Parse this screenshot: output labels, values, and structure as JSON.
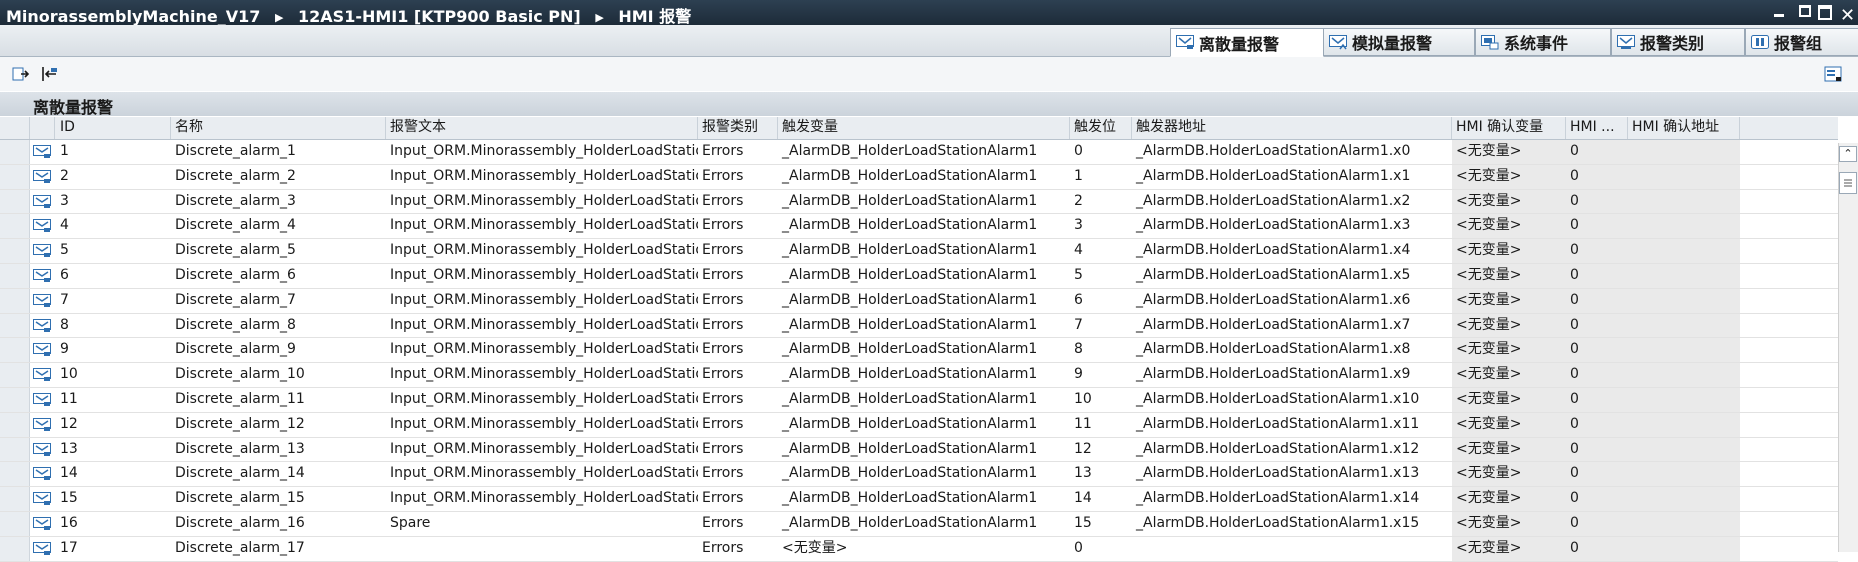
{
  "titlebar": {
    "crumbs": [
      "MinorassemblyMachine_V17",
      "12AS1-HMI1 [KTP900 Basic PN]",
      "HMI 报警"
    ],
    "separator": "▶"
  },
  "tabs": [
    {
      "label": "离散量报警",
      "active": true
    },
    {
      "label": "模拟量报警",
      "active": false
    },
    {
      "label": "系统事件",
      "active": false
    },
    {
      "label": "报警类别",
      "active": false
    },
    {
      "label": "报警组",
      "active": false
    }
  ],
  "section_title": "离散量报警",
  "columns": {
    "id": "ID",
    "name": "名称",
    "text": "报警文本",
    "class": "报警类别",
    "trigger": "触发变量",
    "bit": "触发位",
    "address": "触发器地址",
    "ack": "HMI 确认变量",
    "hmi": "HMI ...",
    "ack_address": "HMI 确认地址"
  },
  "rows": [
    {
      "id": "1",
      "name": "Discrete_alarm_1",
      "text": "Input_ORM.Minorassembly_HolderLoadStatio",
      "cls": "Errors",
      "trig": "_AlarmDB_HolderLoadStationAlarm1",
      "bit": "0",
      "addr": "_AlarmDB.HolderLoadStationAlarm1.x0",
      "ack": "<无变量>",
      "hmi": "0"
    },
    {
      "id": "2",
      "name": "Discrete_alarm_2",
      "text": "Input_ORM.Minorassembly_HolderLoadStatio",
      "cls": "Errors",
      "trig": "_AlarmDB_HolderLoadStationAlarm1",
      "bit": "1",
      "addr": "_AlarmDB.HolderLoadStationAlarm1.x1",
      "ack": "<无变量>",
      "hmi": "0"
    },
    {
      "id": "3",
      "name": "Discrete_alarm_3",
      "text": "Input_ORM.Minorassembly_HolderLoadStatio",
      "cls": "Errors",
      "trig": "_AlarmDB_HolderLoadStationAlarm1",
      "bit": "2",
      "addr": "_AlarmDB.HolderLoadStationAlarm1.x2",
      "ack": "<无变量>",
      "hmi": "0"
    },
    {
      "id": "4",
      "name": "Discrete_alarm_4",
      "text": "Input_ORM.Minorassembly_HolderLoadStatio",
      "cls": "Errors",
      "trig": "_AlarmDB_HolderLoadStationAlarm1",
      "bit": "3",
      "addr": "_AlarmDB.HolderLoadStationAlarm1.x3",
      "ack": "<无变量>",
      "hmi": "0"
    },
    {
      "id": "5",
      "name": "Discrete_alarm_5",
      "text": "Input_ORM.Minorassembly_HolderLoadStatio",
      "cls": "Errors",
      "trig": "_AlarmDB_HolderLoadStationAlarm1",
      "bit": "4",
      "addr": "_AlarmDB.HolderLoadStationAlarm1.x4",
      "ack": "<无变量>",
      "hmi": "0"
    },
    {
      "id": "6",
      "name": "Discrete_alarm_6",
      "text": "Input_ORM.Minorassembly_HolderLoadStatio",
      "cls": "Errors",
      "trig": "_AlarmDB_HolderLoadStationAlarm1",
      "bit": "5",
      "addr": "_AlarmDB.HolderLoadStationAlarm1.x5",
      "ack": "<无变量>",
      "hmi": "0"
    },
    {
      "id": "7",
      "name": "Discrete_alarm_7",
      "text": "Input_ORM.Minorassembly_HolderLoadStatio",
      "cls": "Errors",
      "trig": "_AlarmDB_HolderLoadStationAlarm1",
      "bit": "6",
      "addr": "_AlarmDB.HolderLoadStationAlarm1.x6",
      "ack": "<无变量>",
      "hmi": "0"
    },
    {
      "id": "8",
      "name": "Discrete_alarm_8",
      "text": "Input_ORM.Minorassembly_HolderLoadStatio",
      "cls": "Errors",
      "trig": "_AlarmDB_HolderLoadStationAlarm1",
      "bit": "7",
      "addr": "_AlarmDB.HolderLoadStationAlarm1.x7",
      "ack": "<无变量>",
      "hmi": "0"
    },
    {
      "id": "9",
      "name": "Discrete_alarm_9",
      "text": "Input_ORM.Minorassembly_HolderLoadStatio",
      "cls": "Errors",
      "trig": "_AlarmDB_HolderLoadStationAlarm1",
      "bit": "8",
      "addr": "_AlarmDB.HolderLoadStationAlarm1.x8",
      "ack": "<无变量>",
      "hmi": "0"
    },
    {
      "id": "10",
      "name": "Discrete_alarm_10",
      "text": "Input_ORM.Minorassembly_HolderLoadStatio",
      "cls": "Errors",
      "trig": "_AlarmDB_HolderLoadStationAlarm1",
      "bit": "9",
      "addr": "_AlarmDB.HolderLoadStationAlarm1.x9",
      "ack": "<无变量>",
      "hmi": "0"
    },
    {
      "id": "11",
      "name": "Discrete_alarm_11",
      "text": "Input_ORM.Minorassembly_HolderLoadStatio",
      "cls": "Errors",
      "trig": "_AlarmDB_HolderLoadStationAlarm1",
      "bit": "10",
      "addr": "_AlarmDB.HolderLoadStationAlarm1.x10",
      "ack": "<无变量>",
      "hmi": "0"
    },
    {
      "id": "12",
      "name": "Discrete_alarm_12",
      "text": "Input_ORM.Minorassembly_HolderLoadStatio",
      "cls": "Errors",
      "trig": "_AlarmDB_HolderLoadStationAlarm1",
      "bit": "11",
      "addr": "_AlarmDB.HolderLoadStationAlarm1.x11",
      "ack": "<无变量>",
      "hmi": "0"
    },
    {
      "id": "13",
      "name": "Discrete_alarm_13",
      "text": "Input_ORM.Minorassembly_HolderLoadStatio",
      "cls": "Errors",
      "trig": "_AlarmDB_HolderLoadStationAlarm1",
      "bit": "12",
      "addr": "_AlarmDB.HolderLoadStationAlarm1.x12",
      "ack": "<无变量>",
      "hmi": "0"
    },
    {
      "id": "14",
      "name": "Discrete_alarm_14",
      "text": "Input_ORM.Minorassembly_HolderLoadStatio",
      "cls": "Errors",
      "trig": "_AlarmDB_HolderLoadStationAlarm1",
      "bit": "13",
      "addr": "_AlarmDB.HolderLoadStationAlarm1.x13",
      "ack": "<无变量>",
      "hmi": "0"
    },
    {
      "id": "15",
      "name": "Discrete_alarm_15",
      "text": "Input_ORM.Minorassembly_HolderLoadStatio",
      "cls": "Errors",
      "trig": "_AlarmDB_HolderLoadStationAlarm1",
      "bit": "14",
      "addr": "_AlarmDB.HolderLoadStationAlarm1.x14",
      "ack": "<无变量>",
      "hmi": "0"
    },
    {
      "id": "16",
      "name": "Discrete_alarm_16",
      "text": "Spare",
      "cls": "Errors",
      "trig": "_AlarmDB_HolderLoadStationAlarm1",
      "bit": "15",
      "addr": "_AlarmDB.HolderLoadStationAlarm1.x15",
      "ack": "<无变量>",
      "hmi": "0"
    },
    {
      "id": "17",
      "name": "Discrete_alarm_17",
      "text": "",
      "cls": "Errors",
      "trig": "<无变量>",
      "bit": "0",
      "addr": "",
      "ack": "<无变量>",
      "hmi": "0"
    }
  ],
  "colors": {
    "titlebar": "#1d2b38",
    "icon_blue": "#2f6fb0",
    "header": "#e9edf1"
  }
}
